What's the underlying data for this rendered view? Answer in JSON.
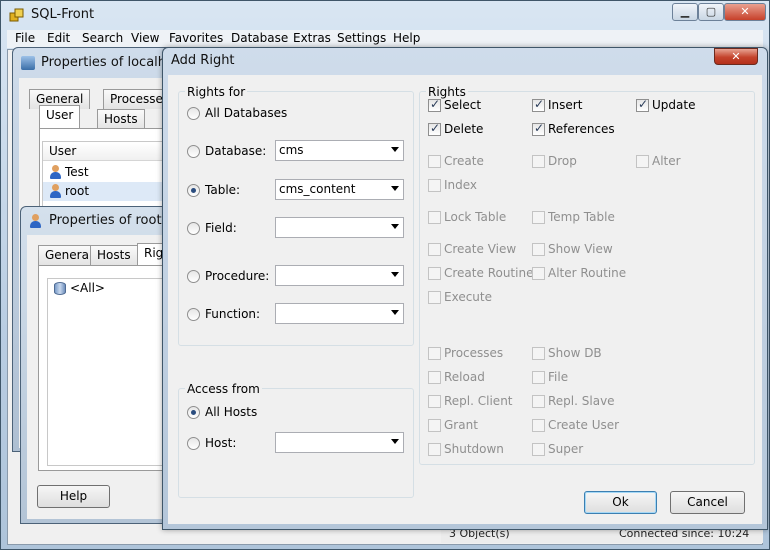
{
  "app": {
    "title": "SQL-Front",
    "menu": [
      "File",
      "Edit",
      "Search",
      "View",
      "Favorites",
      "Database",
      "Extras",
      "Settings",
      "Help"
    ],
    "status_objects": "3 Object(s)",
    "status_connected": "Connected since: 10:24"
  },
  "host_window": {
    "title": "Properties of localhost",
    "tabs_back": [
      "General",
      "Processe"
    ],
    "tabs_front": [
      "User",
      "Hosts"
    ],
    "list_header": "User",
    "users": [
      "Test",
      "root"
    ]
  },
  "root_window": {
    "title": "Properties of root",
    "tabs": [
      "General",
      "Hosts",
      "Rig"
    ],
    "rights_item": "<All>",
    "help_label": "Help"
  },
  "dialog": {
    "title": "Add Right",
    "close_label": "✕",
    "rights_for": {
      "title": "Rights for",
      "options": [
        {
          "label": "All Databases",
          "checked": false,
          "combo": null
        },
        {
          "label": "Database:",
          "checked": false,
          "combo": "cms"
        },
        {
          "label": "Table:",
          "checked": true,
          "combo": "cms_content"
        },
        {
          "label": "Field:",
          "checked": false,
          "combo": ""
        },
        {
          "label": "Procedure:",
          "checked": false,
          "combo": ""
        },
        {
          "label": "Function:",
          "checked": false,
          "combo": ""
        }
      ]
    },
    "access_from": {
      "title": "Access from",
      "all_hosts": "All Hosts",
      "host": "Host:",
      "host_value": ""
    },
    "rights": {
      "title": "Rights",
      "items": [
        {
          "label": "Select",
          "checked": true,
          "enabled": true
        },
        {
          "label": "Insert",
          "checked": true,
          "enabled": true
        },
        {
          "label": "Update",
          "checked": true,
          "enabled": true
        },
        {
          "label": "Delete",
          "checked": true,
          "enabled": true
        },
        {
          "label": "References",
          "checked": true,
          "enabled": true
        },
        {
          "label": "Create",
          "checked": false,
          "enabled": false
        },
        {
          "label": "Drop",
          "checked": false,
          "enabled": false
        },
        {
          "label": "Alter",
          "checked": false,
          "enabled": false
        },
        {
          "label": "Index",
          "checked": false,
          "enabled": false
        },
        {
          "label": "Lock Table",
          "checked": false,
          "enabled": false
        },
        {
          "label": "Temp Table",
          "checked": false,
          "enabled": false
        },
        {
          "label": "Create View",
          "checked": false,
          "enabled": false
        },
        {
          "label": "Show View",
          "checked": false,
          "enabled": false
        },
        {
          "label": "Create Routine",
          "checked": false,
          "enabled": false
        },
        {
          "label": "Alter Routine",
          "checked": false,
          "enabled": false
        },
        {
          "label": "Execute",
          "checked": false,
          "enabled": false
        },
        {
          "label": "Processes",
          "checked": false,
          "enabled": false
        },
        {
          "label": "Show DB",
          "checked": false,
          "enabled": false
        },
        {
          "label": "Reload",
          "checked": false,
          "enabled": false
        },
        {
          "label": "File",
          "checked": false,
          "enabled": false
        },
        {
          "label": "Repl. Client",
          "checked": false,
          "enabled": false
        },
        {
          "label": "Repl. Slave",
          "checked": false,
          "enabled": false
        },
        {
          "label": "Grant",
          "checked": false,
          "enabled": false
        },
        {
          "label": "Create User",
          "checked": false,
          "enabled": false
        },
        {
          "label": "Shutdown",
          "checked": false,
          "enabled": false
        },
        {
          "label": "Super",
          "checked": false,
          "enabled": false
        }
      ]
    },
    "ok_label": "Ok",
    "cancel_label": "Cancel"
  }
}
